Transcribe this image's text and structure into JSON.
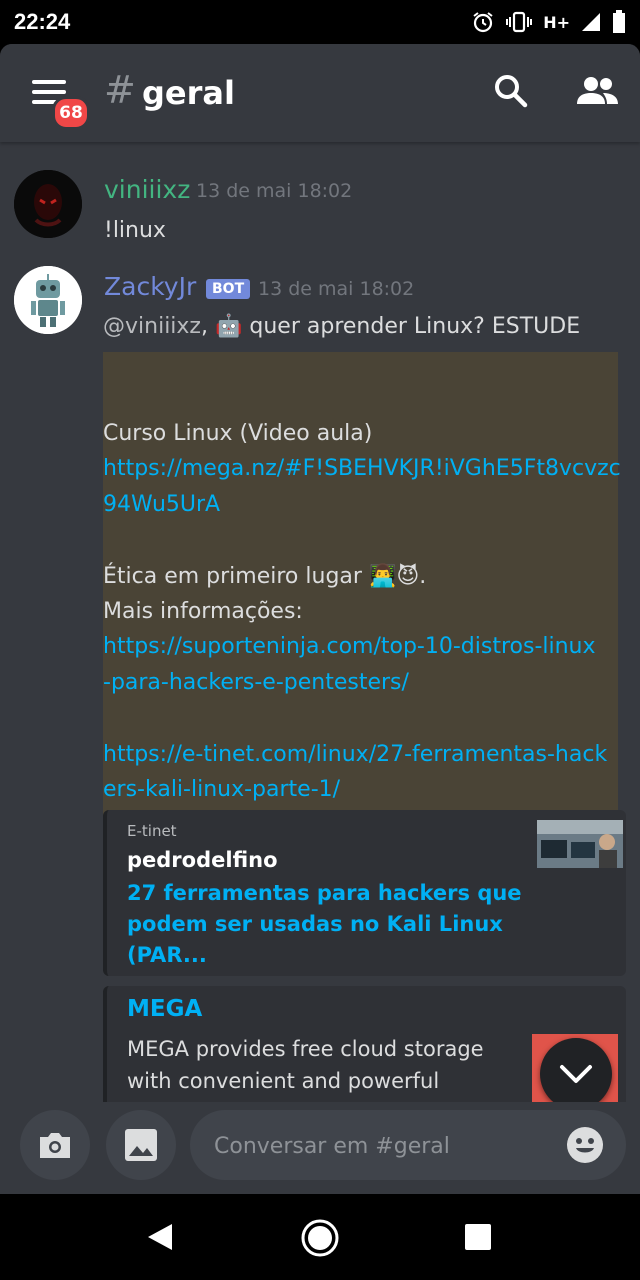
{
  "status": {
    "time": "22:24",
    "network": "H+"
  },
  "header": {
    "hash": "#",
    "channel": "geral",
    "badge": "68"
  },
  "messages": [
    {
      "author": "viniiixz",
      "author_color": "#43b581",
      "timestamp": "13 de mai 18:02",
      "text": "!linux"
    },
    {
      "author": "ZackyJr",
      "author_color": "#7289da",
      "bot_tag": "BOT",
      "timestamp": "13 de mai 18:02",
      "mention": "@viniiixz",
      "line1_rest": "quer aprender Linux? ESTUDE",
      "course_label": " Curso Linux (Video aula)",
      "mega_link_1": "https://mega.nz/#F!SBEHVKJR!iVGhE5Ft8vcvzc",
      "mega_link_2": "94Wu5UrA",
      "ethics": " Ética em primeiro lugar",
      "more_info": " Mais informações:",
      "link2_a": "https://suporteninja.com/top-10-distros-linux",
      "link2_b": "-para-hackers-e-pentesters/",
      "link3_a": "https://e-tinet.com/linux/27-ferramentas-hack",
      "link3_b": "ers-kali-linux-parte-1/"
    }
  ],
  "embeds": [
    {
      "provider": "E-tinet",
      "author": "pedrodelfino",
      "title_lines": [
        "27 ferramentas para hackers que",
        "podem ser usadas no Kali Linux",
        "(PAR..."
      ]
    },
    {
      "title": "MEGA",
      "desc_lines": [
        "MEGA provides free cloud storage",
        "with convenient and powerful"
      ]
    }
  ],
  "composer": {
    "placeholder": "Conversar em #geral"
  }
}
